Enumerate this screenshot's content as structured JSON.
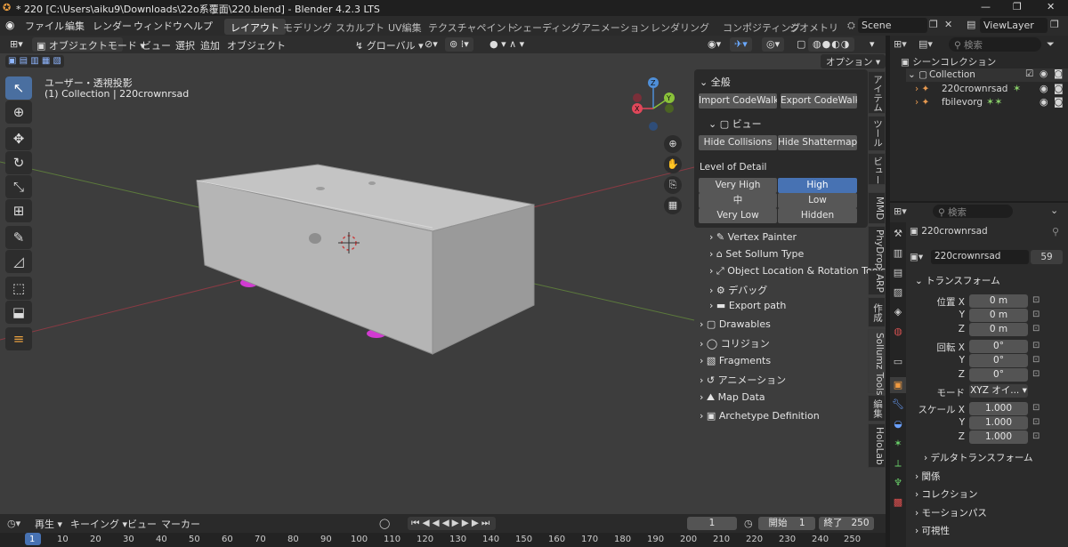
{
  "window": {
    "title": "* 220 [C:\\Users\\aiku9\\Downloads\\22o系覆面\\220.blend] - Blender 4.2.3 LTS",
    "controls": [
      "—",
      "❐",
      "✕"
    ]
  },
  "menubar": {
    "items": [
      "ファイル",
      "編集",
      "レンダー",
      "ウィンドウ",
      "ヘルプ"
    ],
    "workspaces": [
      "レイアウト",
      "モデリング",
      "スカルプト",
      "UV編集",
      "テクスチャペイント",
      "シェーディング",
      "アニメーション",
      "レンダリング",
      "コンポジティング",
      "ジオメトリ"
    ],
    "active_workspace": "レイアウト",
    "scene": "Scene",
    "view_layer": "ViewLayer"
  },
  "header3d": {
    "mode": "オブジェクトモード",
    "menus": [
      "ビュー",
      "選択",
      "追加",
      "オブジェクト"
    ],
    "orientation": "グローバル",
    "options": "オプション"
  },
  "viewport": {
    "view_label": "ユーザー・透視投影",
    "collection_label": "(1) Collection | 220crownrsad",
    "gizmo": {
      "x": "X",
      "y": "Y",
      "z": "Z"
    }
  },
  "npanel": {
    "header": "全般",
    "import_btn": "Import CodeWalk...",
    "export_btn": "Export CodeWalk...",
    "view_section": "ビュー",
    "hide_collisions": "Hide Collisions",
    "hide_shattermaps": "Hide Shattermaps",
    "lod_title": "Level of Detail",
    "lod": [
      [
        "Very High",
        "High"
      ],
      [
        "中",
        "Low"
      ],
      [
        "Very Low",
        "Hidden"
      ]
    ],
    "lod_selected": "High",
    "subsections": [
      "Vertex Painter",
      "Set Sollum Type",
      "Object Location & Rotation Tools",
      "デバッグ",
      "Export path"
    ],
    "sections": [
      "Drawables",
      "コリジョン",
      "Fragments",
      "アニメーション",
      "Map Data",
      "Archetype Definition"
    ]
  },
  "sidetabs": [
    "アイテム",
    "ツール",
    "ビュー",
    "MMD",
    "PhyDrop",
    "ARP",
    "作成",
    "Sollumz Tools",
    "編集",
    "HoloLab"
  ],
  "outliner": {
    "search_placeholder": "検索",
    "root": "シーンコレクション",
    "collection": "Collection",
    "objects": [
      "220crownrsad",
      "fbilevorg"
    ]
  },
  "properties": {
    "search_placeholder": "検索",
    "object_name": "220crownrsad",
    "data_name": "220crownrsad",
    "users": "59",
    "transform_title": "トランスフォーム",
    "location_label": "位置 X",
    "rotation_label": "回転 X",
    "scale_label": "スケール X",
    "y": "Y",
    "z": "Z",
    "location": [
      "0 m",
      "0 m",
      "0 m"
    ],
    "rotation": [
      "0°",
      "0°",
      "0°"
    ],
    "mode_label": "モード",
    "mode_value": "XYZ オイ...",
    "scale": [
      "1.000",
      "1.000",
      "1.000"
    ],
    "delta": "デルタトランスフォーム",
    "panels": [
      "関係",
      "コレクション",
      "モーションパス",
      "可視性"
    ]
  },
  "timeline": {
    "menus": [
      "再生",
      "キーイング",
      "ビュー",
      "マーカー"
    ],
    "current_frame": "1",
    "start_label": "開始",
    "start": "1",
    "end_label": "終了",
    "end": "250",
    "ticks": [
      "1",
      "10",
      "20",
      "30",
      "40",
      "50",
      "60",
      "70",
      "80",
      "90",
      "100",
      "110",
      "120",
      "130",
      "140",
      "150",
      "160",
      "170",
      "180",
      "190",
      "200",
      "210",
      "220",
      "230",
      "240",
      "250"
    ]
  },
  "colors": {
    "accent": "#4772b3",
    "gizmo_x": "#e2475a",
    "gizmo_y": "#8ac23a",
    "gizmo_z": "#4f8fd8",
    "magenta": "#d13bd1"
  }
}
